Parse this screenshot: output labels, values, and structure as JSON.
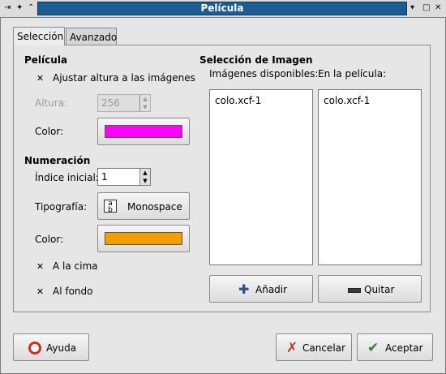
{
  "window": {
    "title": "Película",
    "controls": {
      "menu_icon": "menu-icon",
      "left_glyphs": "⇥ ✦ ⌃",
      "minimize": "▾",
      "maximize": "□",
      "close": "✕"
    }
  },
  "tabs": [
    {
      "label": "Selección",
      "active": true
    },
    {
      "label": "Avanzado",
      "active": false
    }
  ],
  "film": {
    "heading": "Película",
    "fit_height_label": "Ajustar altura a las imágenes",
    "fit_height_checked": true,
    "height_label": "Altura:",
    "height_value": "256",
    "color_label": "Color:",
    "color_value": "#ff00ff"
  },
  "numbering": {
    "heading": "Numeración",
    "start_index_label": "Índice inicial:",
    "start_index_value": "1",
    "font_label": "Tipografía:",
    "font_value": "Monospace",
    "color_label": "Color:",
    "color_value": "#f0a000",
    "at_top_label": "A la cima",
    "at_top_checked": true,
    "at_bottom_label": "Al fondo",
    "at_bottom_checked": true
  },
  "image_selection": {
    "heading": "Selección de Imagen",
    "available_label": "Imágenes disponibles:",
    "in_film_label": "En la película:",
    "available_items": [
      "colo.xcf-1"
    ],
    "film_items": [
      "colo.xcf-1"
    ],
    "add_label": "Añadir",
    "remove_label": "Quitar"
  },
  "footer": {
    "help_label": "Ayuda",
    "cancel_label": "Cancelar",
    "ok_label": "Aceptar"
  }
}
